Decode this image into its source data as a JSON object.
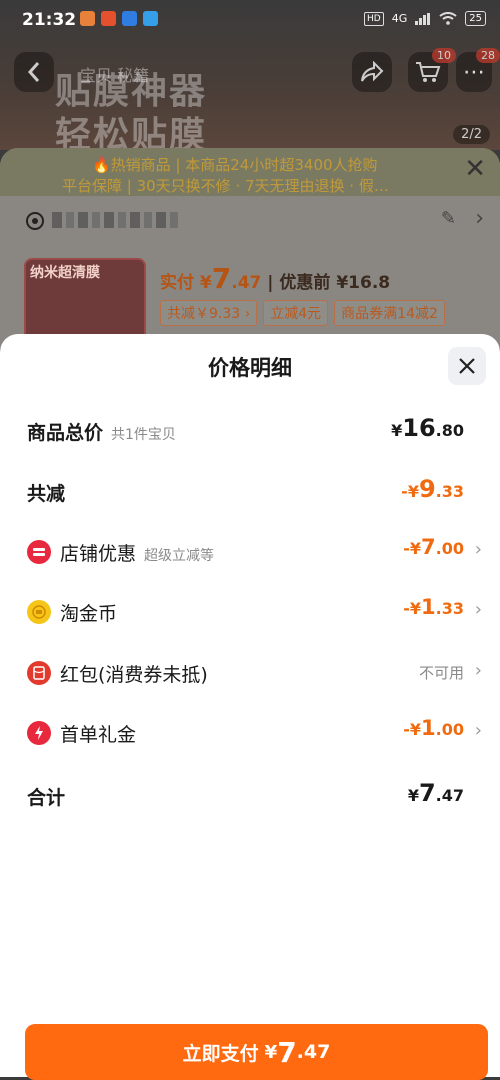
{
  "status_bar": {
    "time": "21:32",
    "hd": "HD",
    "network": "4G",
    "battery": "25"
  },
  "background": {
    "promo_line1": "贴膜神器",
    "promo_line2": "轻松贴膜",
    "promo_top": "宝贝 秘籍",
    "cart_badge": "10",
    "more_badge": "28",
    "page_indicator": "2/2",
    "notice_line1": "🔥热销商品 | 本商品24小时超3400人抢购",
    "notice_line2": "平台保障 | 30天只换不修 · 7天无理由退换 · 假…",
    "product_label": "纳米超清膜",
    "price_prefix": "实付 ¥",
    "price_int": "7",
    "price_dec": ".47",
    "price_before": "| 优惠前 ¥16.8",
    "tags": [
      "共减￥9.33 ›",
      "立减4元",
      "商品券满14减2"
    ]
  },
  "sheet": {
    "title": "价格明细",
    "rows": [
      {
        "label": "商品总价",
        "sub": "共1件宝贝",
        "amount_prefix": "¥",
        "amount_int": "16",
        "amount_dec": ".80"
      },
      {
        "label": "共减",
        "amount_prefix": "-¥",
        "amount_int": "9",
        "amount_dec": ".33"
      },
      {
        "label": "店铺优惠",
        "sub": "超级立减等",
        "amount_prefix": "-¥",
        "amount_int": "7",
        "amount_dec": ".00",
        "icon": "shop-coupon-icon"
      },
      {
        "label": "淘金币",
        "amount_prefix": "-¥",
        "amount_int": "1",
        "amount_dec": ".33",
        "icon": "gold-coin-icon"
      },
      {
        "label": "红包(消费券未抵)",
        "status": "不可用",
        "icon": "red-packet-icon"
      },
      {
        "label": "首单礼金",
        "amount_prefix": "-¥",
        "amount_int": "1",
        "amount_dec": ".00",
        "icon": "lightning-icon"
      },
      {
        "label": "合计",
        "amount_prefix": "¥",
        "amount_int": "7",
        "amount_dec": ".47"
      }
    ]
  },
  "pay_button": {
    "label": "立即支付",
    "yen": "¥",
    "int": "7",
    "dec": ".47"
  },
  "colors": {
    "accent": "#ff6a10",
    "discount": "#f06b10"
  }
}
